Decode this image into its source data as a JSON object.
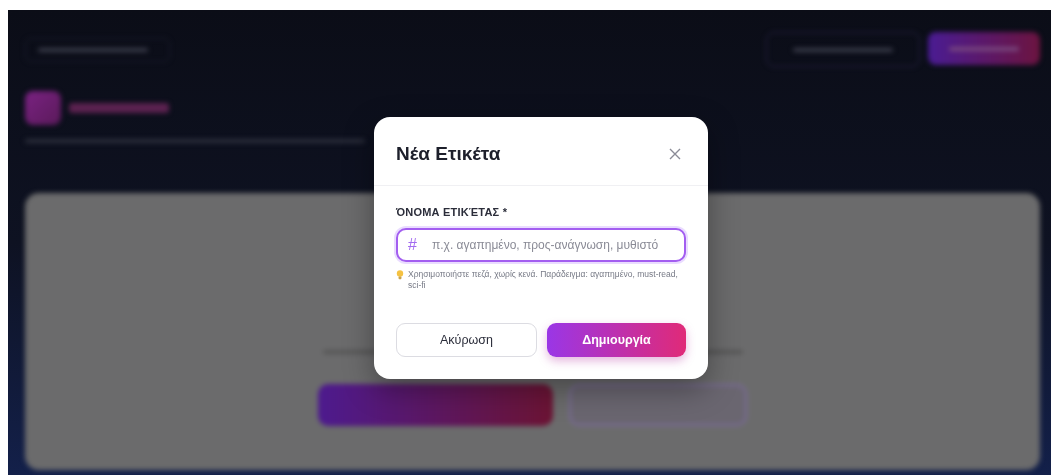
{
  "dialog": {
    "title": "Νέα Ετικέτα",
    "field": {
      "label": "ΌΝΟΜΑ ΕΤΙΚΈΤΑΣ *",
      "prefix": "#",
      "placeholder": "π.χ. αγαπημένο, προς-ανάγνωση, μυθιστό",
      "focused": true
    },
    "hint": "Χρησιμοποιήστε πεζά, χωρίς κενά. Παράδειγμα: αγαπημένο, must-read, sci-fi",
    "buttons": [
      {
        "label": "Ακύρωση",
        "kind": "secondary"
      },
      {
        "label": "Δημιουργία",
        "kind": "primary"
      }
    ]
  }
}
